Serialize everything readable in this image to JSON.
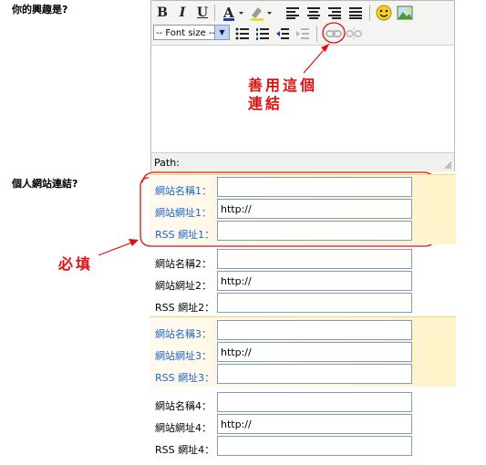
{
  "q_interest": "你的興趣是?",
  "q_site": "個人網站連結?",
  "editor": {
    "font_size_label": "-- Font size --",
    "path_label": "Path:"
  },
  "annotations": {
    "link_hint_line1": "善用這個",
    "link_hint_line2": "連結",
    "required": "必填"
  },
  "groups": [
    {
      "name_label": "網站名稱1：",
      "url_label": "網站網址1：",
      "rss_label": "RSS 網址1：",
      "name_value": "",
      "url_value": "http://",
      "rss_value": ""
    },
    {
      "name_label": "網站名稱2：",
      "url_label": "網站網址2：",
      "rss_label": "RSS 網址2：",
      "name_value": "",
      "url_value": "http://",
      "rss_value": ""
    },
    {
      "name_label": "網站名稱3：",
      "url_label": "網站網址3：",
      "rss_label": "RSS 網址3：",
      "name_value": "",
      "url_value": "http://",
      "rss_value": ""
    },
    {
      "name_label": "網站名稱4：",
      "url_label": "網站網址4：",
      "rss_label": "RSS 網址4：",
      "name_value": "",
      "url_value": "http://",
      "rss_value": ""
    }
  ],
  "colors": {
    "highlight_label": "#1a66c9",
    "annotation_red": "#e01010",
    "band": "#fff3c8"
  }
}
